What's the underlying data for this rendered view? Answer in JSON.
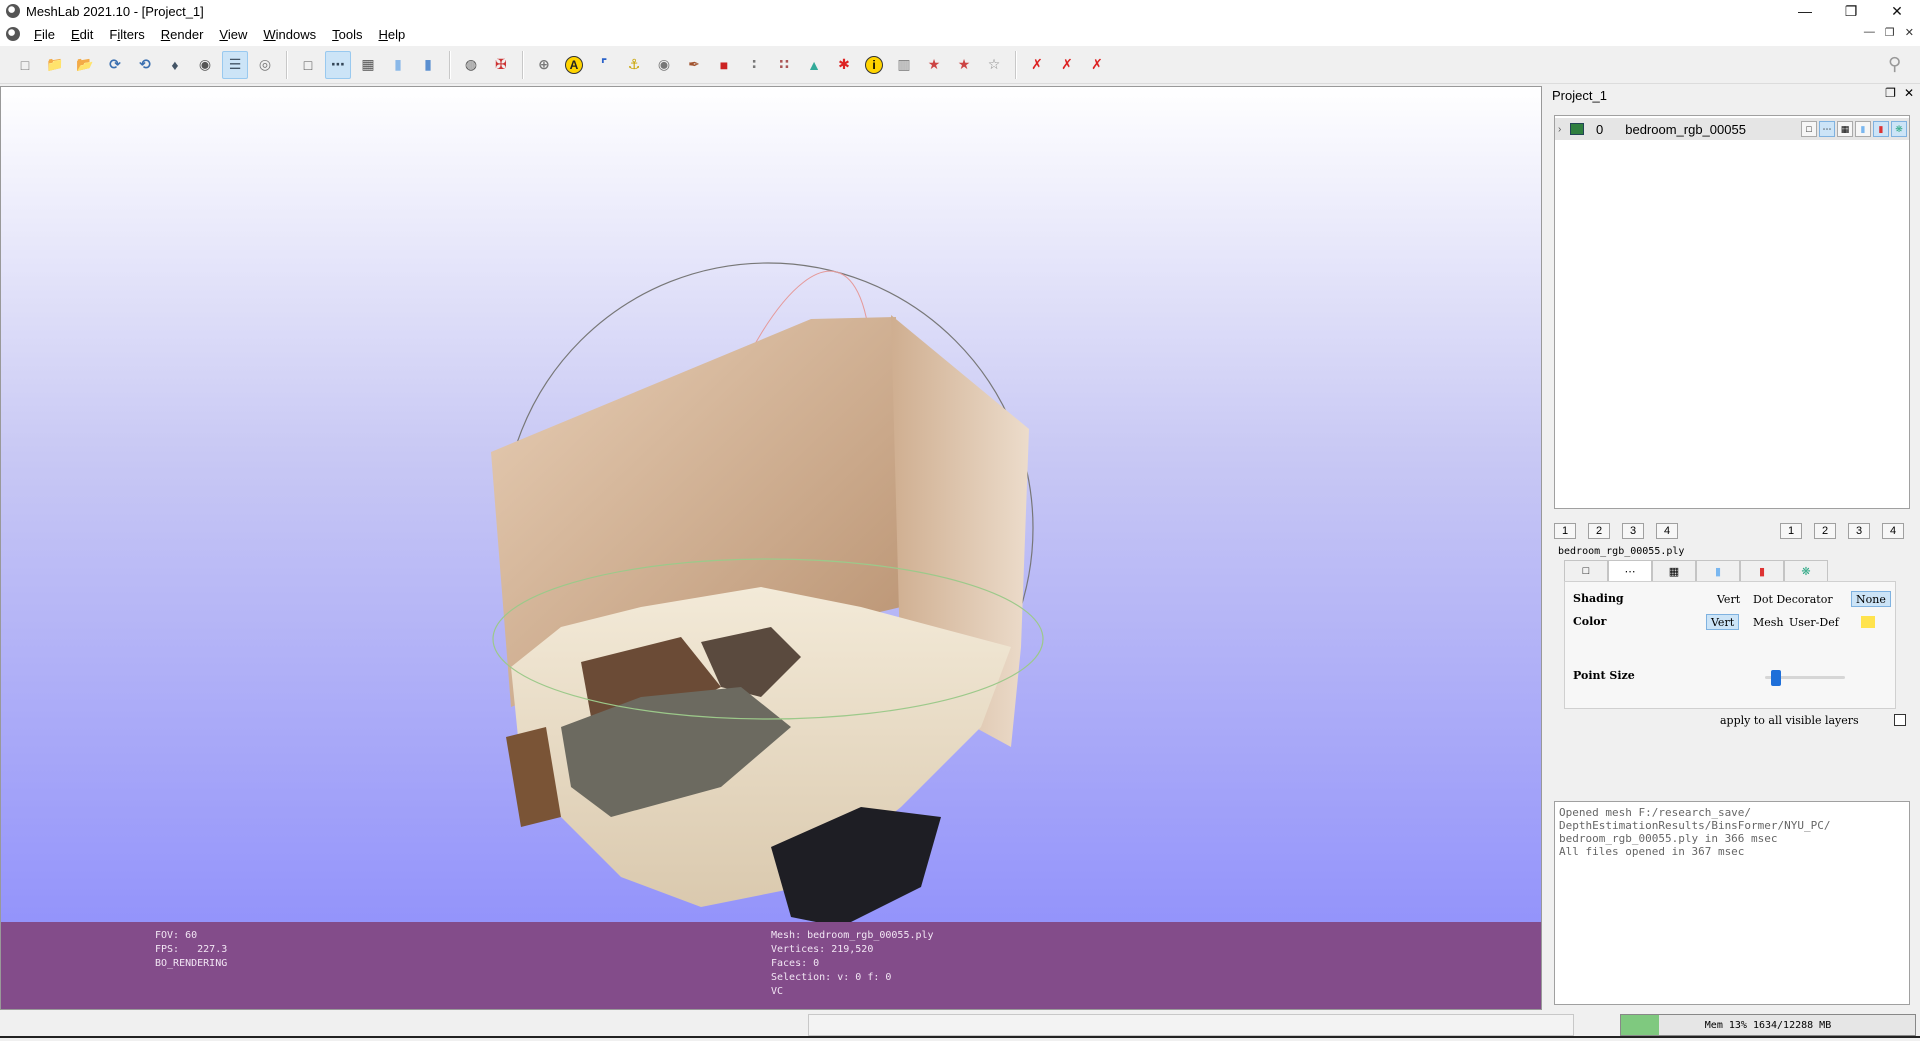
{
  "window": {
    "title": "MeshLab 2021.10 - [Project_1]"
  },
  "menu": [
    {
      "id": "file",
      "pre": "",
      "u": "F",
      "post": "ile"
    },
    {
      "id": "edit",
      "pre": "",
      "u": "E",
      "post": "dit"
    },
    {
      "id": "filters",
      "pre": "F",
      "u": "i",
      "post": "lters"
    },
    {
      "id": "render",
      "pre": "",
      "u": "R",
      "post": "ender"
    },
    {
      "id": "view",
      "pre": "",
      "u": "V",
      "post": "iew"
    },
    {
      "id": "windows",
      "pre": "",
      "u": "W",
      "post": "indows"
    },
    {
      "id": "tools",
      "pre": "",
      "u": "T",
      "post": "ools"
    },
    {
      "id": "help",
      "pre": "",
      "u": "H",
      "post": "elp"
    }
  ],
  "toolbar": {
    "groups": [
      [
        "new-project-icon",
        "open-project-icon",
        "open-folder-icon",
        "reload-icon",
        "reload-all-icon",
        "save-icon",
        "snapshot-icon",
        "layers-dialog-icon",
        "raster-icon"
      ],
      [
        "bbox-render-icon",
        "points-render-icon",
        "wireframe-render-icon",
        "flat-render-icon",
        "smooth-render-icon"
      ],
      [
        "light-icon",
        "axis-cross-icon"
      ],
      [
        "trackball-icon",
        "annotation-icon",
        "measure-axes-icon",
        "manipulator-icon",
        "camera-icon",
        "paint-icon",
        "color-picker-icon",
        "select-vertices-icon",
        "select-faces-icon",
        "align-icon",
        "georef-icon",
        "info-icon",
        "select-area-icon",
        "fix-icon",
        "pickpoints-icon",
        "edit-selection-icon"
      ],
      [
        "delete-vertices-icon",
        "delete-faces-icon",
        "delete-all-icon"
      ]
    ],
    "active": [
      "layers-dialog-icon",
      "points-render-icon"
    ]
  },
  "viewport": {
    "info_left": [
      "FOV: 60",
      "FPS:   227.3",
      "BO_RENDERING"
    ],
    "info_mid": [
      "Mesh: bedroom_rgb_00055.ply",
      "Vertices: 219,520",
      "Faces: 0",
      "Selection: v: 0 f: 0",
      "VC"
    ]
  },
  "project": {
    "title": "Project_1",
    "layers": [
      {
        "index": "0",
        "name": "bedroom_rgb_00055"
      }
    ],
    "left_numbers": [
      "1",
      "2",
      "3",
      "4"
    ],
    "right_numbers": [
      "1",
      "2",
      "3",
      "4"
    ],
    "current_file": "bedroom_rgb_00055.ply",
    "render_tabs": [
      "bbox",
      "points",
      "wire",
      "flat",
      "texture",
      "smooth"
    ],
    "active_tab": "points",
    "shading": {
      "label": "Shading",
      "options": [
        "Vert",
        "Dot Decorator",
        "None"
      ],
      "selected": "None"
    },
    "color": {
      "label": "Color",
      "options": [
        "Vert",
        "Mesh",
        "User-Def"
      ],
      "selected": "Vert",
      "user_color": "#ffe34d"
    },
    "point_size": {
      "label": "Point Size",
      "value_fraction": 0.14
    },
    "apply_all": "apply to all visible layers",
    "log": "Opened mesh F:/research_save/\nDepthEstimationResults/BinsFormer/NYU_PC/\nbedroom_rgb_00055.ply in 366 msec\nAll files opened in 367 msec"
  },
  "status": {
    "memory": "Mem 13% 1634/12288 MB",
    "memory_fraction": 0.13
  }
}
